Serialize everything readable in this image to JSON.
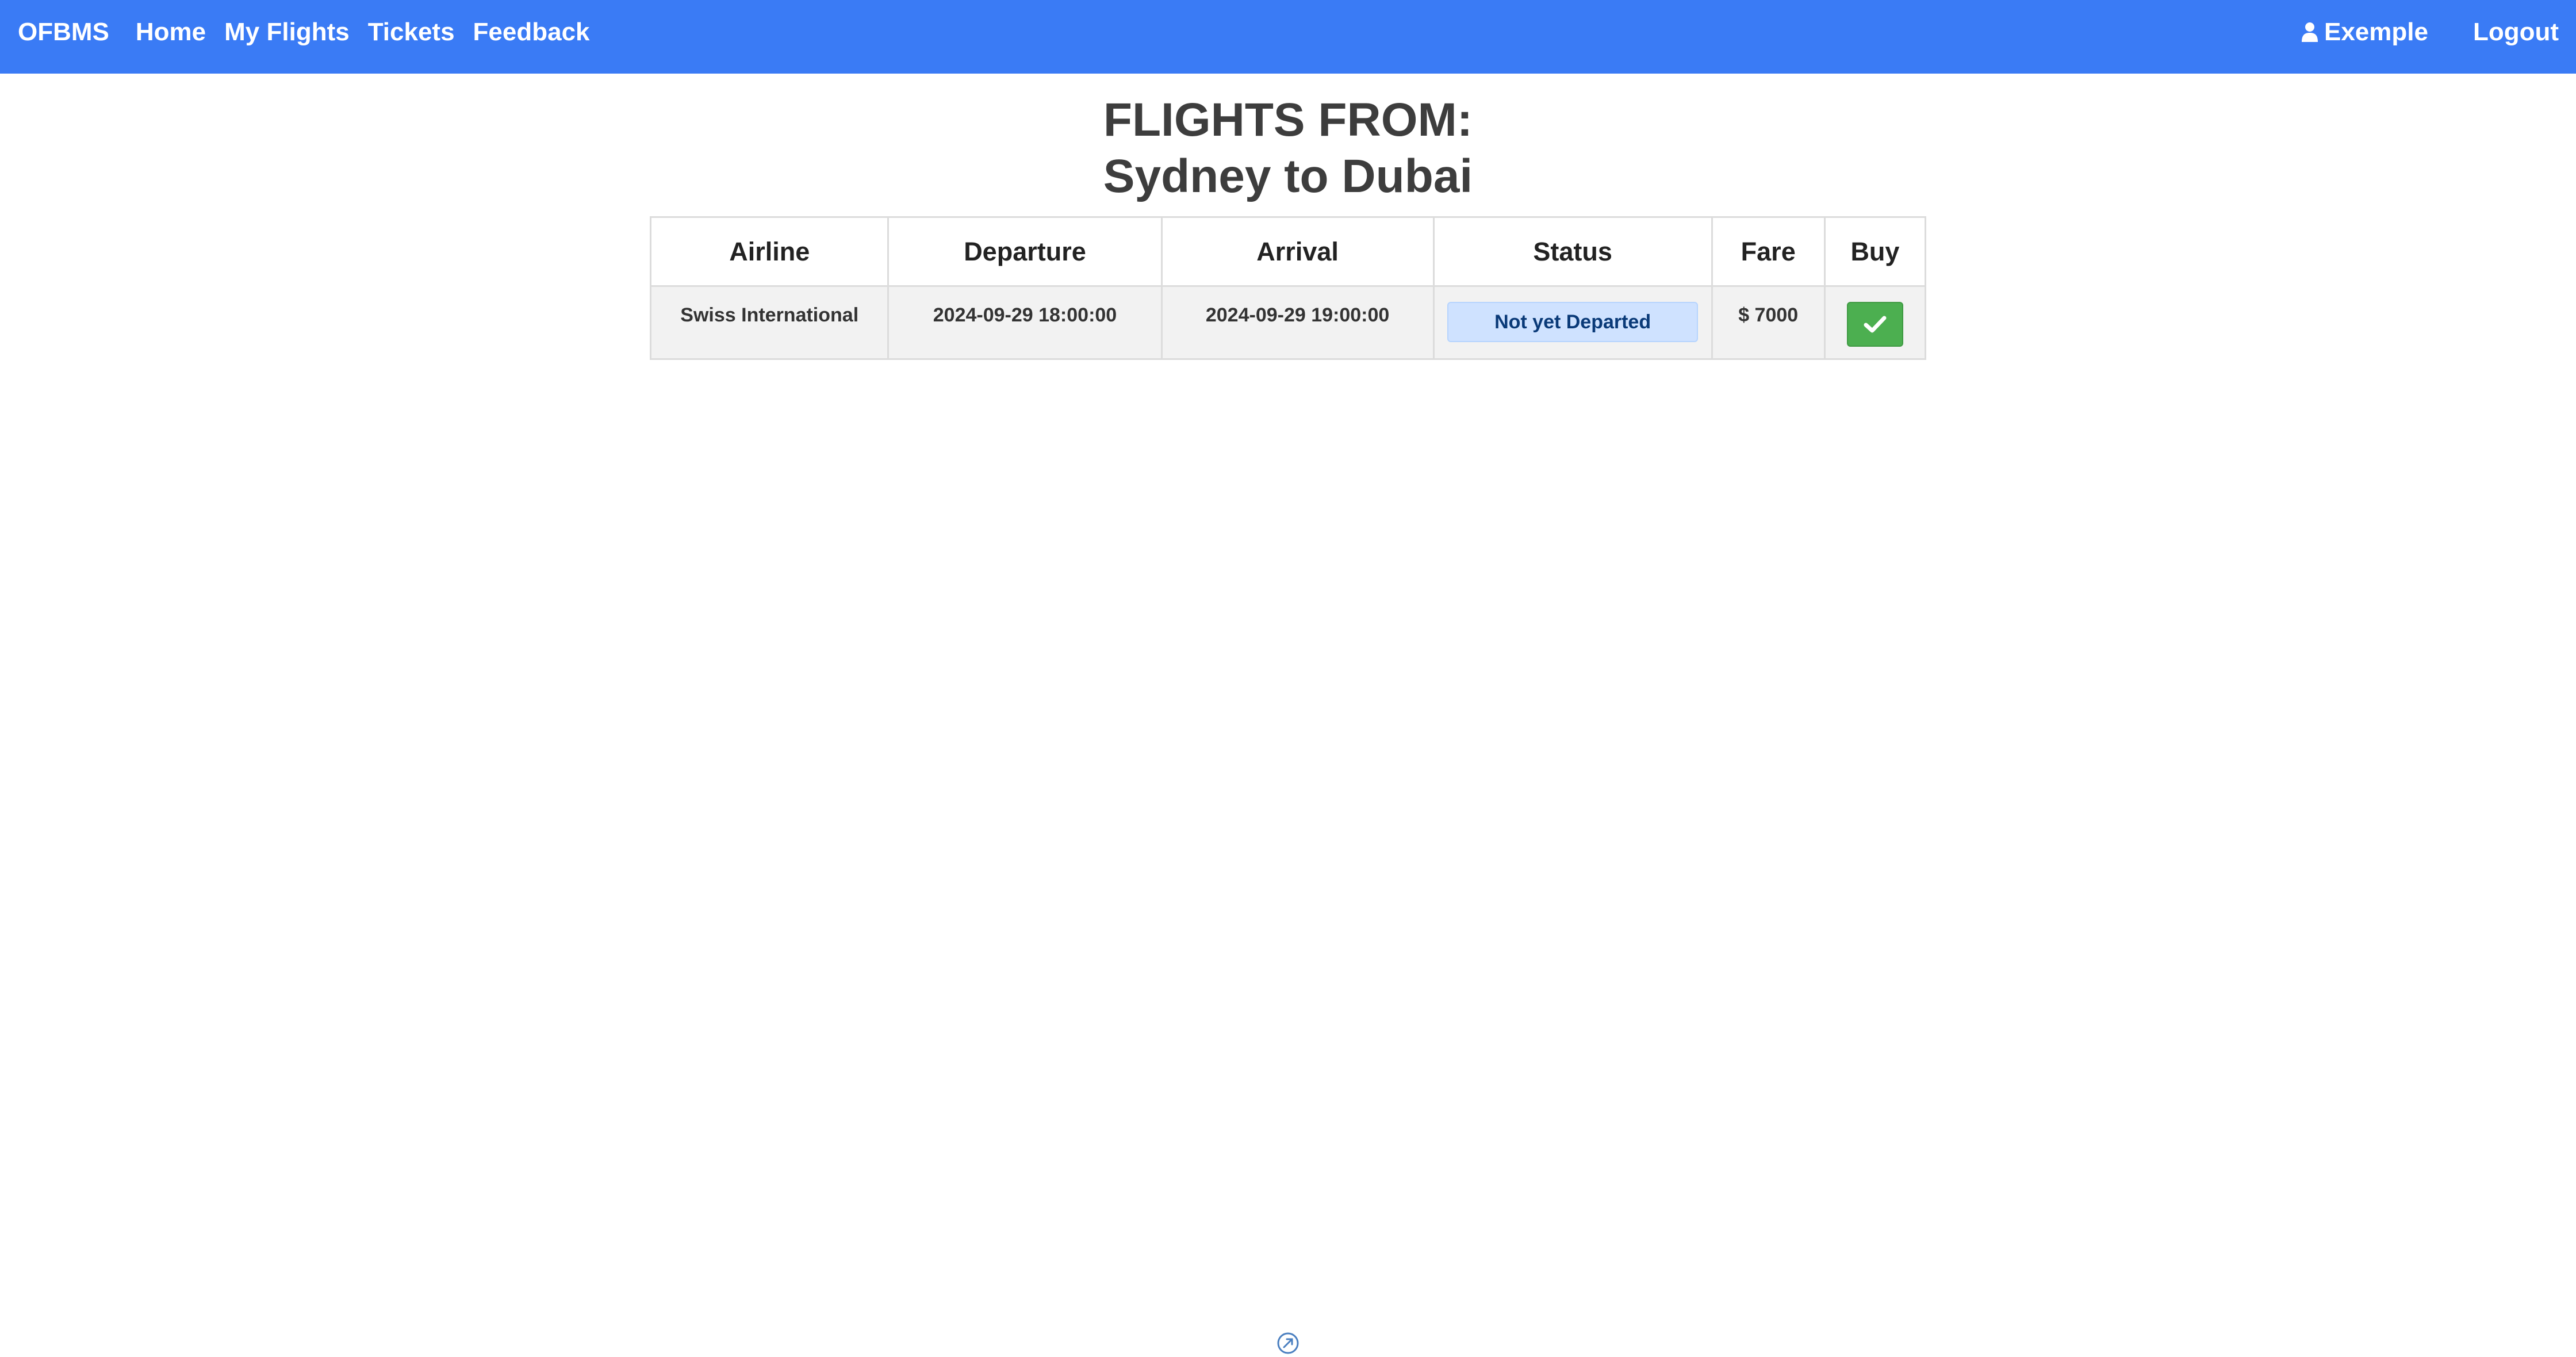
{
  "navbar": {
    "brand": "OFBMS",
    "links": [
      "Home",
      "My Flights",
      "Tickets",
      "Feedback"
    ],
    "user_label": "Exemple",
    "logout_label": "Logout",
    "background_color": "#3a7bf5"
  },
  "heading": {
    "line1": "FLIGHTS FROM:",
    "line2": "Sydney to Dubai"
  },
  "table": {
    "columns": [
      "Airline",
      "Departure",
      "Arrival",
      "Status",
      "Fare",
      "Buy"
    ],
    "rows": [
      {
        "airline": "Swiss International",
        "departure": "2024-09-29 18:00:00",
        "arrival": "2024-09-29 19:00:00",
        "status": "Not yet Departed",
        "fare": "$ 7000",
        "buy_icon": "check-icon"
      }
    ]
  },
  "colors": {
    "status_badge_bg": "#cfe2ff",
    "buy_button_bg": "#4caf50"
  }
}
